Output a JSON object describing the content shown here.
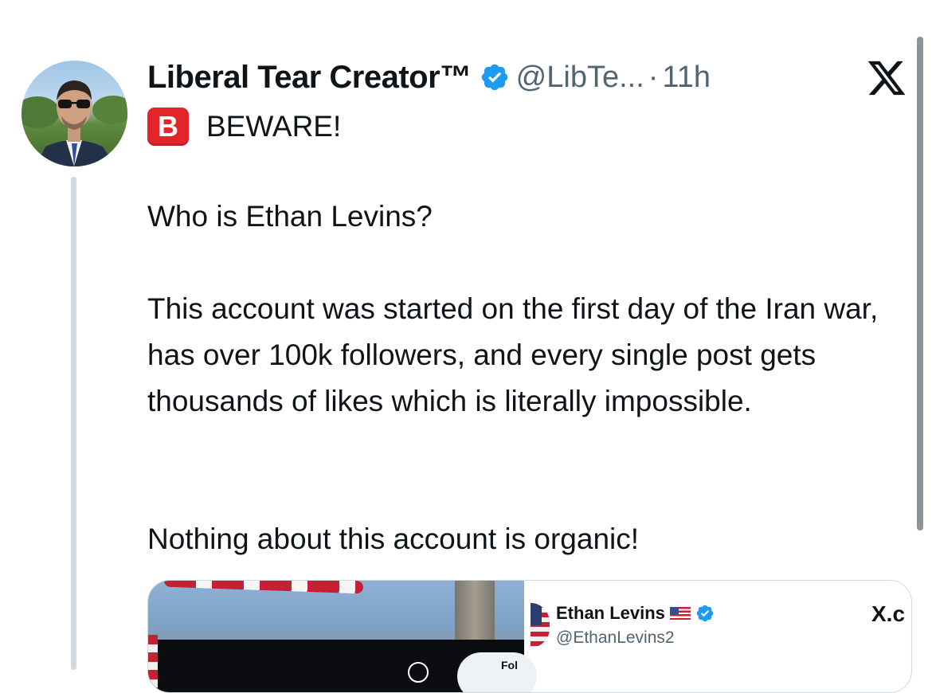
{
  "tweet": {
    "author_name": "Liberal Tear Creator™",
    "handle": "@LibTe...",
    "separator": "·",
    "time": "11h",
    "beware_emoji": "B",
    "beware_text": "BEWARE!",
    "paragraphs": [
      "Who is Ethan Levins?",
      "This account was started on the first day of the Iran war, has over 100k followers, and every single post gets thousands of likes which is literally impossible.",
      "Nothing about this account is organic!"
    ]
  },
  "embedded_card": {
    "name": "Ethan Levins",
    "handle": "@EthanLevins2",
    "site_label": "X.c",
    "follow_partial": "Fol"
  },
  "icons": {
    "verified": "verified-badge-icon",
    "platform": "x-logo-icon",
    "flag": "us-flag-icon",
    "search": "search-icon"
  },
  "colors": {
    "verified_blue": "#1d9bf0",
    "text_primary": "#0f1419",
    "text_secondary": "#536471",
    "thread_line": "#cfd9de",
    "beware_red": "#e3242b"
  }
}
